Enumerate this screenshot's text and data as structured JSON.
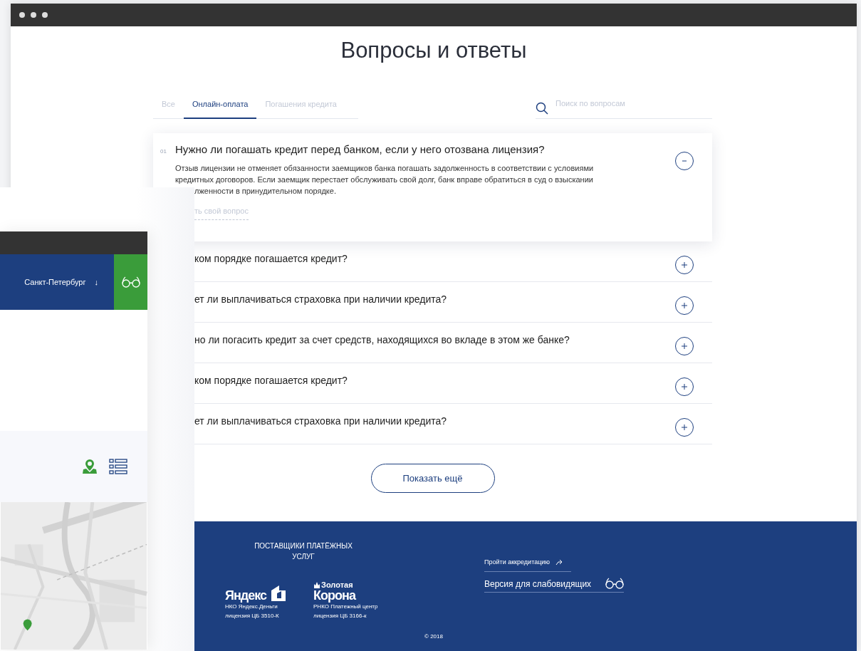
{
  "page": {
    "title": "Вопросы и ответы"
  },
  "tabs": [
    {
      "label": "Все",
      "selected": false
    },
    {
      "label": "Онлайн-оплата",
      "selected": true
    },
    {
      "label": "Погашения кредита",
      "selected": false
    }
  ],
  "search": {
    "placeholder": "Поиск по вопросам"
  },
  "faq": [
    {
      "number": "01",
      "question": "Нужно ли погашать кредит перед банком, если у него отозвана лицензия?",
      "expanded": true,
      "answer_lines": [
        "Отзыв лицензии не отменяет обязанности заемщиков банка погашать задолженность в соответствии с условиями",
        "кредитных договоров. Если заемщик перестает обслуживать свой долг, банк вправе обратиться в суд о взыскании",
        "лженности в принудительном порядке."
      ],
      "link": "ть свой вопрос"
    },
    {
      "question": "ком порядке погашается кредит?",
      "expanded": false
    },
    {
      "question": "ет ли выплачиваться страховка при наличии кредита?",
      "expanded": false
    },
    {
      "question": "но ли погасить кредит за счет средств, находящихся во вкладе в этом же банке?",
      "expanded": false
    },
    {
      "question": "ком порядке погашается кредит?",
      "expanded": false
    },
    {
      "question": "ет ли выплачиваться страховка при наличии кредита?",
      "expanded": false
    }
  ],
  "show_more_button": "Показать ещё",
  "footer": {
    "heading": "ПОСТАВЩИКИ ПЛАТЁЖНЫХ УСЛУГ",
    "partners": [
      {
        "kind": "yandex",
        "logo": "Яндекс",
        "lines": [
          "НКО Яндекс.Деньги",
          "лицензия ЦБ 3510-К"
        ]
      },
      {
        "kind": "korona",
        "logo_top": "Золотая",
        "logo": "Корона",
        "lines": [
          "РНКО Платежный центр",
          "лицензия ЦБ 3166-к"
        ]
      }
    ],
    "links": [
      {
        "kind": "share",
        "label": "Пройти аккредитацию"
      },
      {
        "kind": "glasses",
        "label": "Версия для слабовидящих"
      }
    ],
    "copyright": "© 2018"
  },
  "front_window": {
    "city": "Санкт-Петербург",
    "city_arrow": "↓"
  }
}
